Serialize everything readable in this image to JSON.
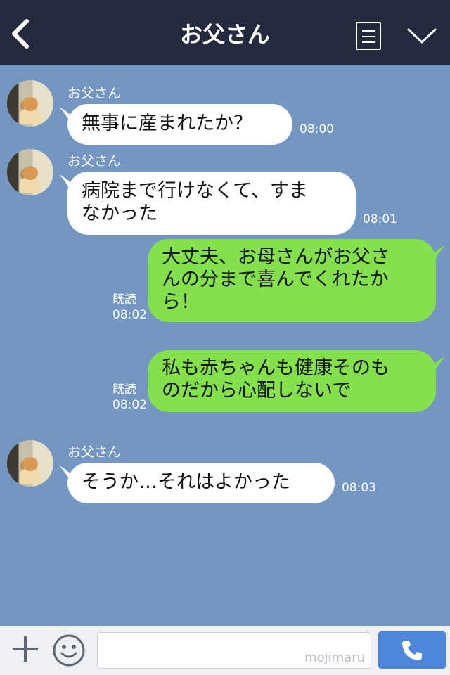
{
  "header": {
    "title": "お父さん"
  },
  "messages": [
    {
      "sender": "お父さん",
      "text": "無事に産まれたか？",
      "time": "08:00"
    },
    {
      "sender": "お父さん",
      "line1": "病院まで行けなくて、すま",
      "line2": "なかった",
      "time": "08:01"
    },
    {
      "line1": "大丈夫、お母さんがお父さ",
      "line2": "んの分まで喜んでくれたか",
      "line3": "ら！",
      "read": "既読",
      "time": "08:02"
    },
    {
      "line1": "私も赤ちゃんも健康そのも",
      "line2": "のだから心配しないで",
      "read": "既読",
      "time": "08:02"
    },
    {
      "sender": "お父さん",
      "text": "そうか…それはよかった",
      "time": "08:03"
    }
  ],
  "input": {
    "watermark": "mojimaru"
  },
  "colors": {
    "header_bg": "#232a3d",
    "chat_bg": "#7396c3",
    "incoming_bubble": "#ffffff",
    "outgoing_bubble": "#84e14b",
    "call_button": "#4e86db"
  },
  "icons": [
    "back-arrow-icon",
    "menu-list-icon",
    "chevron-down-icon",
    "avatar-image",
    "plus-icon",
    "emoji-icon",
    "phone-icon"
  ]
}
